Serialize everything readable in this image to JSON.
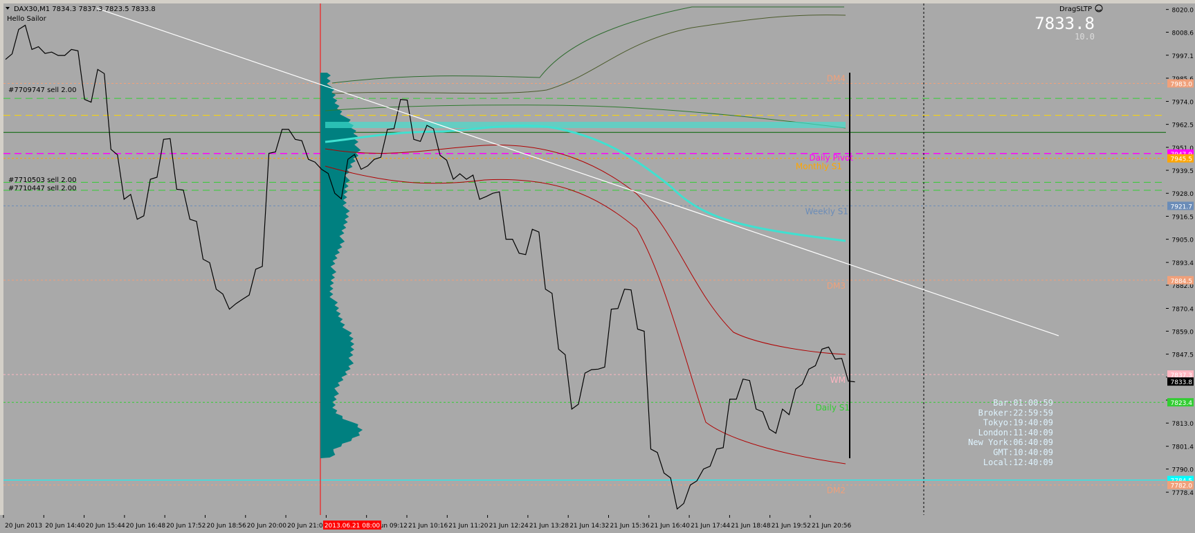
{
  "header": {
    "symbol_line": "DAX30,M1  7834.3 7837.3 7823.5 7833.8",
    "subtitle": "Hello Sailor",
    "expert_name": "DragSLTP",
    "price_big": "7833.8",
    "spread": "10.0"
  },
  "orders": [
    "#7709747 sell 2.00",
    "#7710503 sell 2.00",
    "#7710447 sell 2.00"
  ],
  "level_labels": {
    "dm4": "DM4",
    "daily_pivot": "Daily Pivot",
    "monthly_s1": "Monthly S1",
    "weekly_s1": "Weekly S1",
    "dm3": "DM3",
    "wm": "WM",
    "daily_s1": "Daily S1",
    "dm2": "DM2"
  },
  "clocks": [
    "Bar:01:00:59",
    "Broker:22:59:59",
    "Tokyo:19:40:09",
    "London:11:40:09",
    "New York:06:40:09",
    "GMT:10:40:09",
    "Local:12:40:09"
  ],
  "time_highlight": "2013.06.21 08:00",
  "chart_data": {
    "type": "line",
    "symbol": "DAX30",
    "timeframe": "M1",
    "ylim": [
      7767,
      8023
    ],
    "y_ticks": [
      "8020.0",
      "8008.6",
      "7997.1",
      "7985.6",
      "7974.0",
      "7962.5",
      "7951.0",
      "7939.5",
      "7928.0",
      "7916.5",
      "7905.0",
      "7893.4",
      "7882.0",
      "7870.4",
      "7859.0",
      "7847.5",
      "7836.0",
      "7824.5",
      "7813.0",
      "7801.4",
      "7790.0",
      "7778.4"
    ],
    "x_ticks": [
      "20 Jun 2013",
      "20 Jun 14:40",
      "20 Jun 15:44",
      "20 Jun 16:48",
      "20 Jun 17:52",
      "20 Jun 18:56",
      "20 Jun 20:00",
      "20 Jun 21:04",
      "21 Jun 08:08",
      "21 Jun 09:12",
      "21 Jun 10:16",
      "21 Jun 11:20",
      "21 Jun 12:24",
      "21 Jun 13:28",
      "21 Jun 14:32",
      "21 Jun 15:36",
      "21 Jun 16:40",
      "21 Jun 17:44",
      "21 Jun 18:48",
      "21 Jun 19:52",
      "21 Jun 20:56"
    ],
    "price_tags": [
      {
        "value": 7983.0,
        "label": "7983.0",
        "color": "#f0a07a"
      },
      {
        "value": 7947.9,
        "label": "7947.9",
        "color": "#ff00ff"
      },
      {
        "value": 7945.5,
        "label": "7945.5",
        "color": "#ffa500"
      },
      {
        "value": 7921.7,
        "label": "7921.7",
        "color": "#6a8cb8"
      },
      {
        "value": 7884.5,
        "label": "7884.5",
        "color": "#f0a07a"
      },
      {
        "value": 7837.3,
        "label": "7837.3",
        "color": "#ffb6c1"
      },
      {
        "value": 7833.8,
        "label": "7833.8",
        "color": "#000000"
      },
      {
        "value": 7823.4,
        "label": "7823.4",
        "color": "#32cd32"
      },
      {
        "value": 7784.5,
        "label": "7784.5",
        "color": "#00ffff"
      },
      {
        "value": 7782.0,
        "label": "7782.0",
        "color": "#f0a07a"
      }
    ],
    "levels": [
      {
        "name": "DM4",
        "value": 7983.0,
        "color": "#f0a07a",
        "style": "dot"
      },
      {
        "name": "Daily Pivot",
        "value": 7947.9,
        "color": "#ff00ff",
        "style": "dash"
      },
      {
        "name": "Monthly S1",
        "value": 7945.5,
        "color": "#ffa500",
        "style": "dot"
      },
      {
        "name": "Weekly S1",
        "value": 7921.7,
        "color": "#6a8cb8",
        "style": "dot"
      },
      {
        "name": "DM3",
        "value": 7884.5,
        "color": "#f0a07a",
        "style": "dot"
      },
      {
        "name": "WM",
        "value": 7837.3,
        "color": "#ffb6c1",
        "style": "dot"
      },
      {
        "name": "Daily S1",
        "value": 7823.4,
        "color": "#32cd32",
        "style": "dot"
      },
      {
        "name": "DM2",
        "value": 7782.0,
        "color": "#f0a07a",
        "style": "dot"
      },
      {
        "name": "",
        "value": 7784.5,
        "color": "#00ffff",
        "style": "solid"
      },
      {
        "name": "",
        "value": 7975.5,
        "color": "#32cd32",
        "style": "dash"
      },
      {
        "name": "",
        "value": 7967.0,
        "color": "#ffd700",
        "style": "dash"
      },
      {
        "name": "",
        "value": 7958.5,
        "color": "#006400",
        "style": "solid"
      },
      {
        "name": "",
        "value": 7933.5,
        "color": "#32cd32",
        "style": "dash"
      },
      {
        "name": "",
        "value": 7929.5,
        "color": "#32cd32",
        "style": "dash"
      }
    ],
    "price_series": {
      "name": "",
      "x": [
        0,
        0.02,
        0.035,
        0.05,
        0.07,
        0.09,
        0.1,
        0.115,
        0.13,
        0.145,
        0.16,
        0.17,
        0.2,
        0.23,
        0.265,
        0.3,
        0.33,
        0.36,
        0.38,
        0.4,
        0.41,
        0.42,
        0.44,
        0.47,
        0.5,
        0.52,
        0.54,
        0.56,
        0.58,
        0.6,
        0.63,
        0.65,
        0.68,
        0.7,
        0.72,
        0.74,
        0.76,
        0.77,
        0.79,
        0.8,
        0.82,
        0.84,
        0.86,
        0.88,
        0.9,
        0.92,
        0.94,
        0.96,
        0.98,
        1.0
      ],
      "y": [
        7995,
        8010,
        8000,
        7998,
        7997,
        8000,
        7975,
        7990,
        7950,
        7925,
        7915,
        7935,
        7955,
        7930,
        7915,
        7895,
        7880,
        7870,
        7875,
        7890,
        7948,
        7960,
        7955,
        7945,
        7940,
        7928,
        7945,
        7940,
        7945,
        7960,
        7975,
        7955,
        7962,
        7947,
        7935,
        7935,
        7925,
        7928,
        7905,
        7898,
        7910,
        7880,
        7850,
        7820,
        7838,
        7840,
        7870,
        7880,
        7860,
        7800,
        7788,
        7770,
        7782,
        7790,
        7800,
        7825,
        7835,
        7820,
        7810,
        7820,
        7830,
        7840,
        7850,
        7845,
        7834
      ],
      "yunits": "price"
    }
  }
}
